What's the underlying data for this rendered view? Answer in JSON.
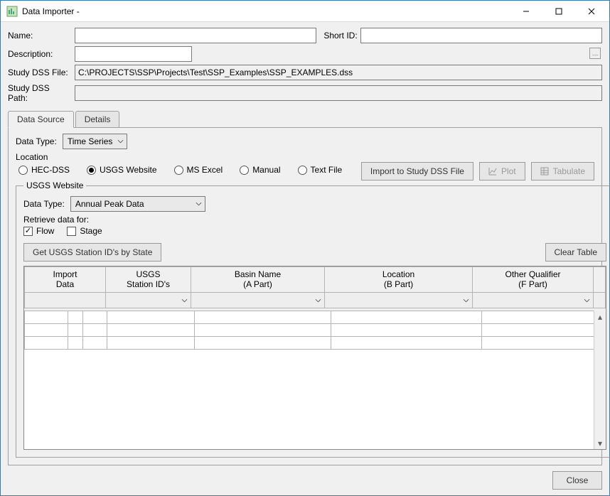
{
  "window": {
    "title": "Data Importer -"
  },
  "labels": {
    "name": "Name:",
    "short_id": "Short ID:",
    "description": "Description:",
    "study_dss_file": "Study DSS File:",
    "study_dss_path": "Study DSS Path:"
  },
  "values": {
    "name": "",
    "short_id": "",
    "description": "",
    "study_dss_file": "C:\\PROJECTS\\SSP\\Projects\\Test\\SSP_Examples\\SSP_EXAMPLES.dss",
    "study_dss_path": ""
  },
  "tabs": {
    "data_source": "Data Source",
    "details": "Details"
  },
  "datasource": {
    "data_type_label": "Data Type:",
    "data_type_value": "Time Series",
    "location_label": "Location",
    "radios": {
      "hec_dss": "HEC-DSS",
      "usgs": "USGS Website",
      "msexcel": "MS Excel",
      "manual": "Manual",
      "textfile": "Text File"
    },
    "buttons": {
      "import": "Import to Study DSS File",
      "plot": "Plot",
      "tabulate": "Tabulate"
    }
  },
  "usgs": {
    "legend": "USGS Website",
    "data_type_label": "Data Type:",
    "data_type_value": "Annual Peak Data",
    "retrieve_label": "Retrieve data for:",
    "flow": "Flow",
    "stage": "Stage",
    "get_ids": "Get USGS Station ID's by State",
    "clear": "Clear Table",
    "headers": {
      "import_data_l1": "Import",
      "import_data_l2": "Data",
      "station_l1": "USGS",
      "station_l2": "Station ID's",
      "basin_l1": "Basin Name",
      "basin_l2": "(A Part)",
      "location_l1": "Location",
      "location_l2": "(B Part)",
      "other_l1": "Other Qualifier",
      "other_l2": "(F Part)"
    }
  },
  "footer": {
    "close": "Close"
  }
}
